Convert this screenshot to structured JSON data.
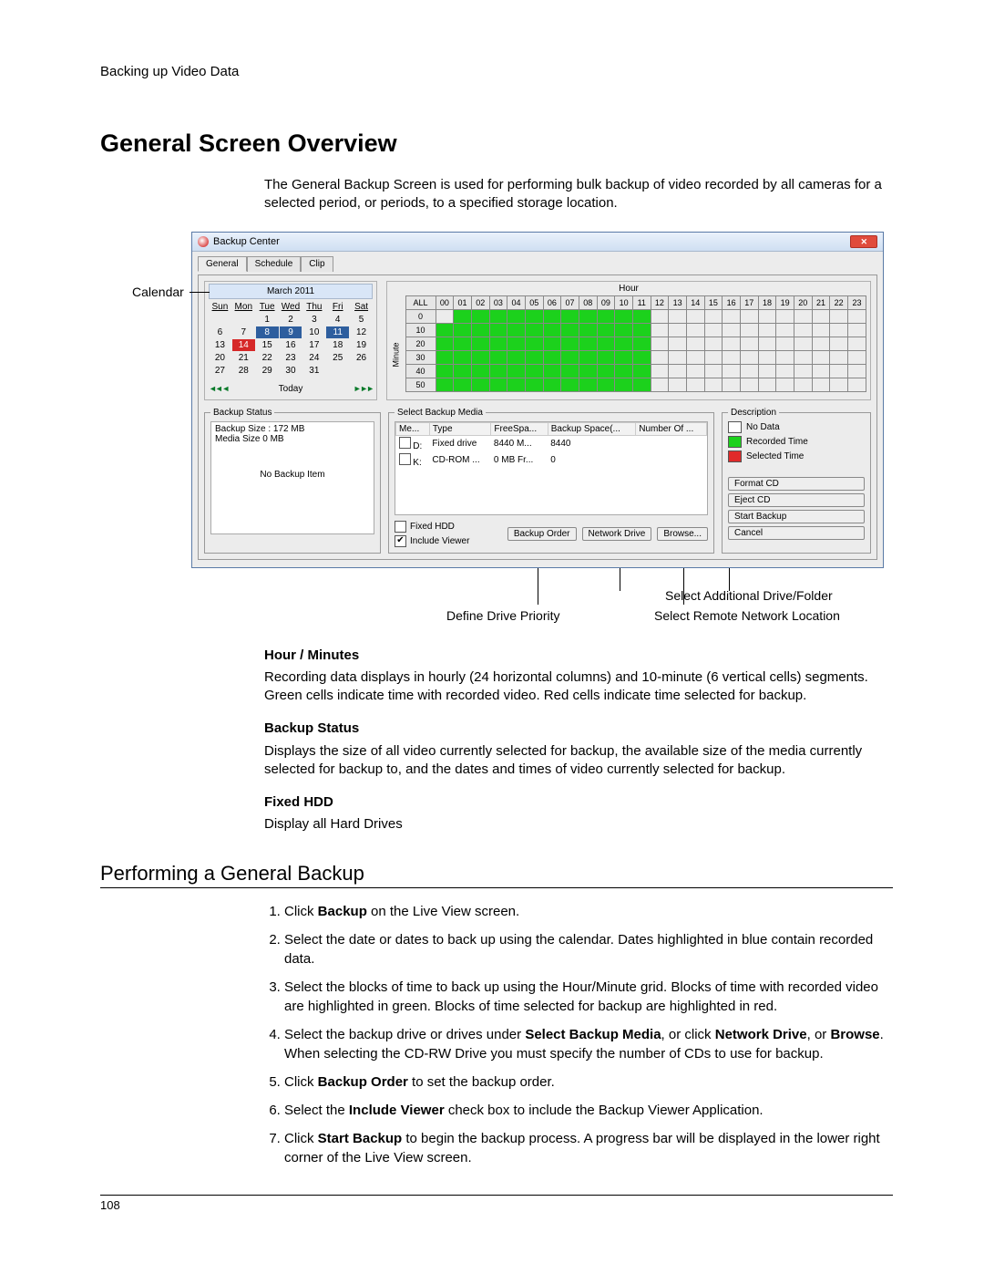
{
  "header_path": "Backing up Video Data",
  "h1": "General Screen Overview",
  "intro": "The General Backup Screen is used for performing bulk backup of video recorded by all cameras for a selected period, or periods, to a specified storage location.",
  "callout_calendar": "Calendar",
  "window": {
    "title": "Backup Center",
    "tabs": [
      "General",
      "Schedule",
      "Clip"
    ],
    "active_tab": 0
  },
  "calendar": {
    "month": "March 2011",
    "weekdays": [
      "Sun",
      "Mon",
      "Tue",
      "Wed",
      "Thu",
      "Fri",
      "Sat"
    ],
    "rows": [
      [
        "",
        "",
        "1",
        "2",
        "3",
        "4",
        "5"
      ],
      [
        "6",
        "7",
        "8",
        "9",
        "10",
        "11",
        "12"
      ],
      [
        "13",
        "14",
        "15",
        "16",
        "17",
        "18",
        "19"
      ],
      [
        "20",
        "21",
        "22",
        "23",
        "24",
        "25",
        "26"
      ],
      [
        "27",
        "28",
        "29",
        "30",
        "31",
        "",
        ""
      ]
    ],
    "blue_days": [
      "8",
      "9",
      "11"
    ],
    "red_days": [
      "14"
    ],
    "today_label": "Today"
  },
  "hour_grid": {
    "title": "Hour",
    "side_label": "Minute",
    "all_label": "ALL",
    "hours": [
      "00",
      "01",
      "02",
      "03",
      "04",
      "05",
      "06",
      "07",
      "08",
      "09",
      "10",
      "11",
      "12",
      "13",
      "14",
      "15",
      "16",
      "17",
      "18",
      "19",
      "20",
      "21",
      "22",
      "23"
    ],
    "minutes": [
      "0",
      "10",
      "20",
      "30",
      "40",
      "50"
    ],
    "green_until_hour": 11
  },
  "backup_status": {
    "legend": "Backup Status",
    "size_line": "Backup Size : 172 MB",
    "media_line": "Media Size 0 MB",
    "none_line": "No Backup Item"
  },
  "select_media": {
    "legend": "Select Backup Media",
    "headers": [
      "Me...",
      "Type",
      "FreeSpa...",
      "Backup Space(...",
      "Number Of ..."
    ],
    "rows": [
      {
        "chk": false,
        "drive": "D:",
        "type": "Fixed drive",
        "free": "8440 M...",
        "space": "8440",
        "num": ""
      },
      {
        "chk": false,
        "drive": "K:",
        "type": "CD-ROM ...",
        "free": "0 MB Fr...",
        "space": "0",
        "num": ""
      }
    ],
    "fixed_hdd_label": "Fixed HDD",
    "include_viewer_label": "Include Viewer",
    "backup_order_btn": "Backup Order",
    "network_drive_btn": "Network Drive",
    "browse_btn": "Browse..."
  },
  "description": {
    "legend": "Description",
    "no_data": "No Data",
    "recorded_time": "Recorded Time",
    "selected_time": "Selected Time",
    "btn_format": "Format CD",
    "btn_eject": "Eject CD",
    "btn_start": "Start Backup",
    "btn_cancel": "Cancel"
  },
  "callouts_below": {
    "c1": "Define Drive Priority",
    "c2": "Select Remote Network Location",
    "c3": "Select Additional Drive/Folder"
  },
  "sections": {
    "hour_h": "Hour / Minutes",
    "hour_p": "Recording data displays in hourly (24 horizontal columns) and 10-minute (6 vertical cells) segments. Green cells indicate time with recorded video. Red cells indicate time selected for backup.",
    "status_h": "Backup Status",
    "status_p": "Displays the size of all video currently selected for backup, the available size of the media currently selected for backup to, and the dates and times of video currently selected for backup.",
    "fixed_h": "Fixed HDD",
    "fixed_p": "Display all Hard Drives"
  },
  "h2": "Performing a General Backup",
  "steps": {
    "s1a": "Click ",
    "s1b": "Backup",
    "s1c": " on the Live View screen.",
    "s2": "Select the date or dates to back up using the calendar. Dates highlighted in blue contain recorded data.",
    "s3": "Select the blocks of time to back up using the Hour/Minute grid. Blocks of time with recorded video are highlighted in green. Blocks of time selected for backup are highlighted in red.",
    "s4a": "Select the backup drive or drives under ",
    "s4b": "Select Backup Media",
    "s4c": ", or click ",
    "s4d": "Network Drive",
    "s4e": ", or ",
    "s4f": "Browse",
    "s4g": ". When selecting the CD-RW Drive you must specify the number of CDs to use for backup.",
    "s5a": "Click ",
    "s5b": "Backup Order",
    "s5c": " to set the backup order.",
    "s6a": "Select the ",
    "s6b": "Include Viewer",
    "s6c": " check box to include the Backup Viewer Application.",
    "s7a": "Click ",
    "s7b": "Start Backup",
    "s7c": " to begin the backup process.  A progress bar will be displayed in the lower right corner of the Live View screen."
  },
  "page_number": "108"
}
